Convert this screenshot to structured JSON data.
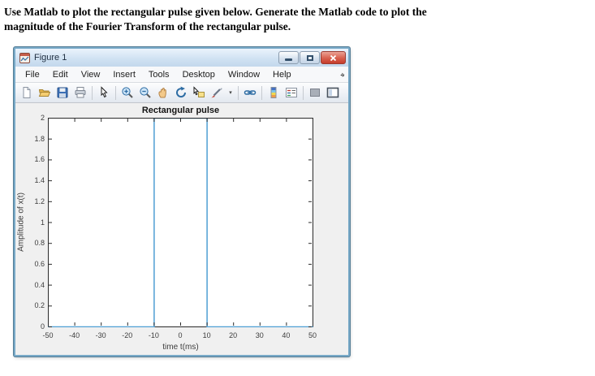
{
  "heading": {
    "line1": "Use Matlab to plot the rectangular pulse given below. Generate the Matlab code to plot the",
    "line2": "magnitude of the Fourier Transform of the rectangular pulse."
  },
  "window": {
    "title": "Figure 1",
    "icon": "matlab-figure-icon",
    "controls": [
      "minimize-button",
      "maximize-button",
      "close-button"
    ]
  },
  "menu": {
    "items": [
      "File",
      "Edit",
      "View",
      "Insert",
      "Tools",
      "Desktop",
      "Window",
      "Help"
    ],
    "overflow_icon": "menu-overflow-chevron"
  },
  "toolbar": {
    "icons": [
      "new-figure-icon",
      "open-file-icon",
      "save-figure-icon",
      "print-figure-icon",
      "separator",
      "edit-plot-pointer-icon",
      "separator",
      "zoom-in-icon",
      "zoom-out-icon",
      "pan-icon",
      "rotate-3d-icon",
      "data-cursor-icon",
      "brush-data-icon",
      "brush-dropdown-arrow",
      "separator",
      "link-plot-icon",
      "separator",
      "insert-colorbar-icon",
      "insert-legend-icon",
      "separator",
      "hide-plot-tools-icon",
      "show-plot-tools-icon"
    ]
  },
  "chart_data": {
    "type": "line",
    "title": "Rectangular pulse",
    "xlabel": "time t(ms)",
    "ylabel": "Amplitude of x(t)",
    "xlim": [
      -50,
      50
    ],
    "ylim": [
      0,
      2
    ],
    "xticks": [
      -50,
      -40,
      -30,
      -20,
      -10,
      0,
      10,
      20,
      30,
      40,
      50
    ],
    "yticks": [
      0,
      0.2,
      0.4,
      0.6,
      0.8,
      1,
      1.2,
      1.4,
      1.6,
      1.8,
      2
    ],
    "grid": false,
    "legend": "none",
    "series": [
      {
        "name": "rectangular pulse x(t)",
        "color": "#4f9fd4",
        "x": [
          -50,
          -10,
          -10,
          10,
          10,
          50
        ],
        "y": [
          0,
          0,
          2,
          2,
          0,
          0
        ]
      }
    ]
  },
  "colors": {
    "pulse_line": "#4f9fd4",
    "window_border": "#79aac8",
    "titlebar": "#cfe1f2",
    "close_button": "#d8604e",
    "figure_background": "#f0f0f0",
    "axes_frame": "#2b2b2b"
  }
}
